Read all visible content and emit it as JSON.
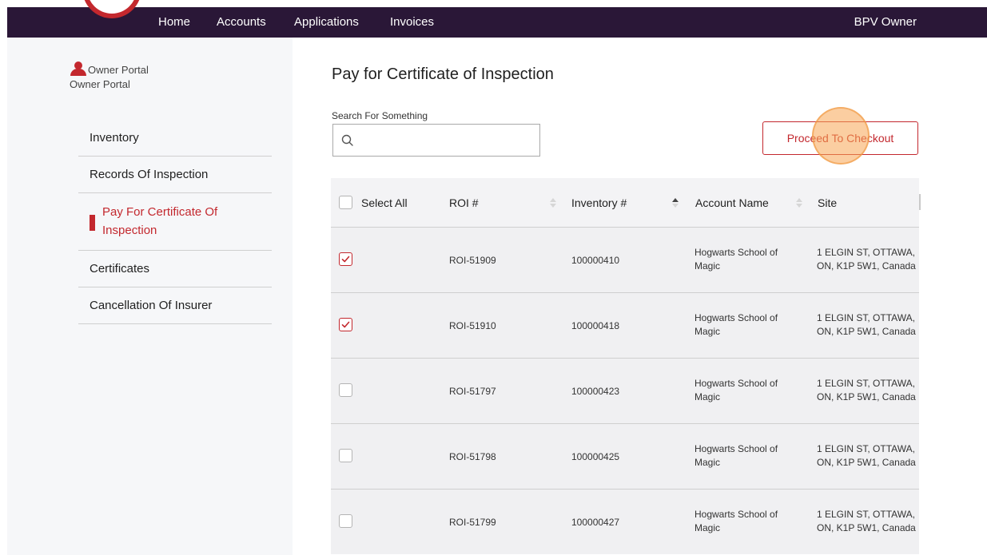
{
  "nav": {
    "items": [
      "Home",
      "Accounts",
      "Applications",
      "Invoices"
    ],
    "user": "BPV Owner"
  },
  "sidebar": {
    "portal_title": "Owner Portal",
    "portal_subtitle": "Owner Portal",
    "items": [
      {
        "label": "Inventory"
      },
      {
        "label": "Records Of Inspection"
      },
      {
        "label": "Pay For Certificate Of Inspection",
        "active": true
      },
      {
        "label": "Certificates"
      },
      {
        "label": "Cancellation Of Insurer"
      }
    ]
  },
  "main": {
    "title": "Pay for Certificate of Inspection",
    "search_label": "Search For Something",
    "search_value": "",
    "checkout_label": "Proceed To Checkout"
  },
  "table": {
    "select_all_label": "Select All",
    "columns": [
      "ROI #",
      "Inventory #",
      "Account Name",
      "Site"
    ],
    "rows": [
      {
        "checked": true,
        "roi": "ROI-51909",
        "inventory": "100000410",
        "account": "Hogwarts School of Magic",
        "site": "1 ELGIN ST, OTTAWA, ON, K1P 5W1, Canada"
      },
      {
        "checked": true,
        "roi": "ROI-51910",
        "inventory": "100000418",
        "account": "Hogwarts School of Magic",
        "site": "1 ELGIN ST, OTTAWA, ON, K1P 5W1, Canada"
      },
      {
        "checked": false,
        "roi": "ROI-51797",
        "inventory": "100000423",
        "account": "Hogwarts School of Magic",
        "site": "1 ELGIN ST, OTTAWA, ON, K1P 5W1, Canada"
      },
      {
        "checked": false,
        "roi": "ROI-51798",
        "inventory": "100000425",
        "account": "Hogwarts School of Magic",
        "site": "1 ELGIN ST, OTTAWA, ON, K1P 5W1, Canada"
      },
      {
        "checked": false,
        "roi": "ROI-51799",
        "inventory": "100000427",
        "account": "Hogwarts School of Magic",
        "site": "1 ELGIN ST, OTTAWA, ON, K1P 5W1, Canada"
      }
    ]
  },
  "colors": {
    "nav_bg": "#2a1737",
    "accent": "#c3282e",
    "sidebar_bg": "#f6f7f9",
    "row_bg": "#f0f0f2"
  },
  "icons": {
    "search": "search-icon",
    "person": "person-icon",
    "sort": "sort-icon",
    "check": "checkmark-icon"
  }
}
